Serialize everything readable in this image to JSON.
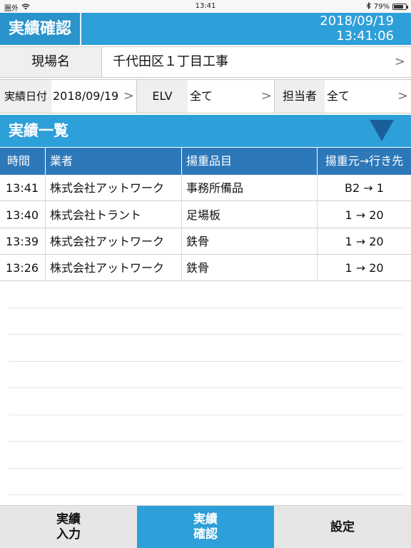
{
  "status_bar": {
    "carrier": "圏外",
    "wifi_icon": "wifi-icon",
    "time": "13:41",
    "bluetooth_icon": "bluetooth-icon",
    "battery_percent": "79%",
    "battery_level": 0.79
  },
  "header": {
    "title": "実績確認",
    "date": "2018/09/19",
    "time": "13:41:06"
  },
  "site": {
    "label": "現場名",
    "value": "千代田区１丁目工事",
    "chevron": ">"
  },
  "filters": {
    "date_label": "実績日付",
    "date_value": "2018/09/19",
    "elv_label": "ELV",
    "elv_value": "全て",
    "person_label": "担当者",
    "person_value": "全て",
    "chevron": ">"
  },
  "section": {
    "title": "実績一覧",
    "toggle_icon": "triangle-down-icon"
  },
  "table": {
    "headers": [
      "時間",
      "業者",
      "揚重品目",
      "揚重元→行き先"
    ],
    "rows": [
      [
        "13:41",
        "株式会社アットワーク",
        "事務所備品",
        "B2 → 1"
      ],
      [
        "13:40",
        "株式会社トラント",
        "足場板",
        "1 → 20"
      ],
      [
        "13:39",
        "株式会社アットワーク",
        "鉄骨",
        "1 → 20"
      ],
      [
        "13:26",
        "株式会社アットワーク",
        "鉄骨",
        "1 → 20"
      ]
    ]
  },
  "tabs": [
    {
      "label": "実績\n入力",
      "active": false
    },
    {
      "label": "実績\n確認",
      "active": true
    },
    {
      "label": "設定",
      "active": false
    }
  ],
  "colors": {
    "primary": "#2d9fd9",
    "table_header": "#2d78b8",
    "triangle": "#1b5f9a"
  }
}
